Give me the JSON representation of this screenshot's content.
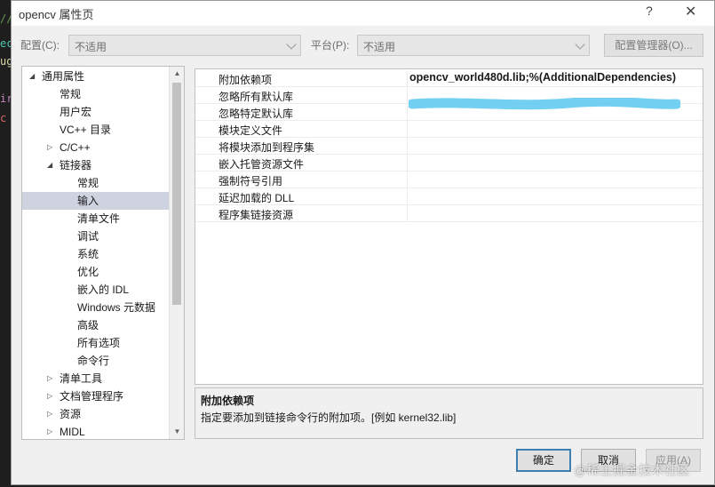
{
  "dialog": {
    "title": "opencv 属性页",
    "help_glyph": "?",
    "close_glyph": "✕"
  },
  "toolbar": {
    "config_label": "配置(C):",
    "config_value": "不适用",
    "platform_label": "平台(P):",
    "platform_value": "不适用",
    "config_manager_label": "配置管理器(O)..."
  },
  "tree": {
    "items": [
      {
        "label": "通用属性",
        "expander": "◢",
        "level": 0
      },
      {
        "label": "常规",
        "expander": "",
        "level": 1
      },
      {
        "label": "用户宏",
        "expander": "",
        "level": 1
      },
      {
        "label": "VC++ 目录",
        "expander": "",
        "level": 1
      },
      {
        "label": "C/C++",
        "expander": "▷",
        "level": 1
      },
      {
        "label": "链接器",
        "expander": "◢",
        "level": 1
      },
      {
        "label": "常规",
        "expander": "",
        "level": 2
      },
      {
        "label": "输入",
        "expander": "",
        "level": 2,
        "selected": true
      },
      {
        "label": "清单文件",
        "expander": "",
        "level": 2
      },
      {
        "label": "调试",
        "expander": "",
        "level": 2
      },
      {
        "label": "系统",
        "expander": "",
        "level": 2
      },
      {
        "label": "优化",
        "expander": "",
        "level": 2
      },
      {
        "label": "嵌入的 IDL",
        "expander": "",
        "level": 2
      },
      {
        "label": "Windows 元数据",
        "expander": "",
        "level": 2
      },
      {
        "label": "高级",
        "expander": "",
        "level": 2
      },
      {
        "label": "所有选项",
        "expander": "",
        "level": 2
      },
      {
        "label": "命令行",
        "expander": "",
        "level": 2
      },
      {
        "label": "清单工具",
        "expander": "▷",
        "level": 1
      },
      {
        "label": "文档管理程序",
        "expander": "▷",
        "level": 1
      },
      {
        "label": "资源",
        "expander": "▷",
        "level": 1
      },
      {
        "label": "MIDL",
        "expander": "▷",
        "level": 1
      }
    ],
    "scroll_up_glyph": "▲",
    "scroll_down_glyph": "▼"
  },
  "properties": {
    "rows": [
      {
        "name": "附加依赖项",
        "value": "opencv_world480d.lib;%(AdditionalDependencies)"
      },
      {
        "name": "忽略所有默认库",
        "value": ""
      },
      {
        "name": "忽略特定默认库",
        "value": ""
      },
      {
        "name": "模块定义文件",
        "value": ""
      },
      {
        "name": "将模块添加到程序集",
        "value": ""
      },
      {
        "name": "嵌入托管资源文件",
        "value": ""
      },
      {
        "name": "强制符号引用",
        "value": ""
      },
      {
        "name": "延迟加载的 DLL",
        "value": ""
      },
      {
        "name": "程序集链接资源",
        "value": ""
      }
    ]
  },
  "description": {
    "title": "附加依赖项",
    "text": "指定要添加到链接命令行的附加项。[例如 kernel32.lib]"
  },
  "buttons": {
    "ok": "确定",
    "cancel": "取消",
    "apply": "应用(A)"
  },
  "watermark": "@稀土掘金技术社区",
  "colors": {
    "selection": "#cfd3e0",
    "highlight_scribble": "#5cc8f0"
  }
}
